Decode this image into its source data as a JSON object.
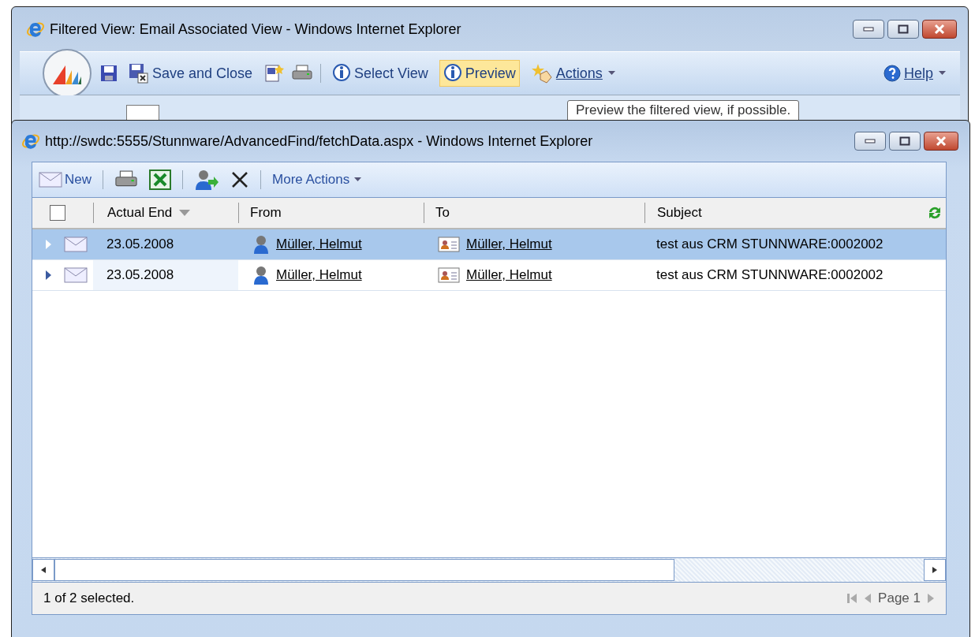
{
  "back_window": {
    "title": "Filtered View: Email Associated View - Windows Internet Explorer",
    "toolbar": {
      "save_and_close": "Save and Close",
      "select_view": "Select View",
      "preview": {
        "label": "Preview",
        "highlighted": true
      },
      "actions": "Actions",
      "help": "Help"
    },
    "tooltip": "Preview the filtered view, if possible."
  },
  "front_window": {
    "title": "http://swdc:5555/Stunnware/AdvancedFind/fetchData.aspx - Windows Internet Explorer",
    "toolbar": {
      "new": "New",
      "more_actions": "More Actions"
    },
    "grid": {
      "select_all_checked": false,
      "columns": [
        {
          "label": "Actual End",
          "sorted": true
        },
        {
          "label": "From",
          "sorted": false
        },
        {
          "label": "To",
          "sorted": false
        },
        {
          "label": "Subject",
          "sorted": false
        }
      ],
      "rows": [
        {
          "selected": true,
          "actual_end": "23.05.2008",
          "from": "Müller, Helmut",
          "to": "Müller, Helmut",
          "subject": "test aus CRM STUNNWARE:0002002"
        },
        {
          "selected": false,
          "actual_end": "23.05.2008",
          "from": "Müller, Helmut",
          "to": "Müller, Helmut",
          "subject": "test aus CRM STUNNWARE:0002002"
        }
      ]
    },
    "status": "1 of 2 selected.",
    "pager": "Page 1"
  }
}
